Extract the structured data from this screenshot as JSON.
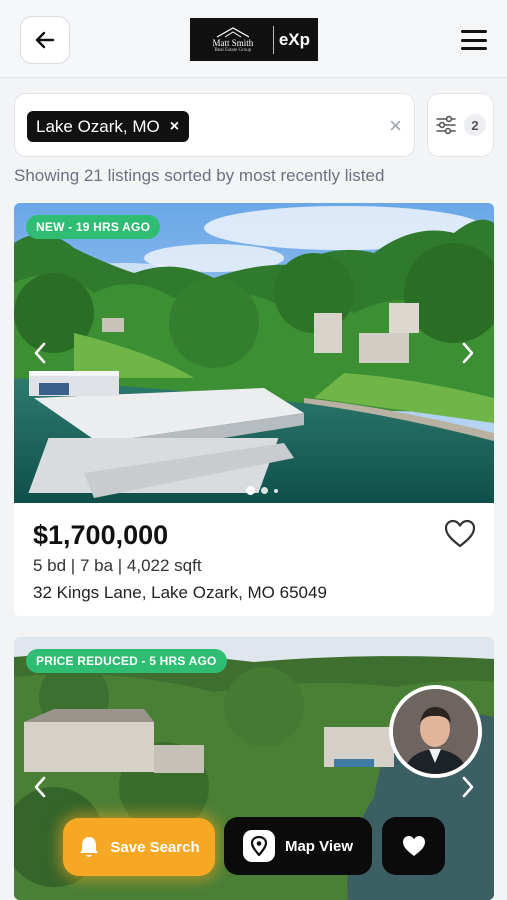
{
  "header": {
    "back_icon": "arrow-left-icon",
    "logo": {
      "name": "Matt Smith",
      "sub": "Real Estate Group",
      "brand": "eXp"
    },
    "menu_icon": "hamburger-menu-icon"
  },
  "search": {
    "chip_label": "Lake Ozark, MO",
    "chip_remove": "×",
    "clear": "×",
    "filter_icon": "sliders-icon",
    "filter_count": "2",
    "results_text": "Showing 21 listings sorted by most recently listed"
  },
  "listings": [
    {
      "badge": "NEW - 19 HRS AGO",
      "badge_color": "#2fbd73",
      "price": "$1,700,000",
      "specs": "5 bd | 7 ba | 4,022 sqft",
      "address": "32 Kings Lane, Lake Ozark, MO 65049",
      "photo_count": 3,
      "photo_index": 1
    },
    {
      "badge": "PRICE REDUCED - 5 HRS AGO",
      "badge_color": "#2fbd73"
    }
  ],
  "actions": {
    "save_search": "Save Search",
    "save_search_icon": "bell-icon",
    "map_view": "Map View",
    "map_view_icon": "map-pin-icon",
    "favorites_icon": "heart-icon",
    "accent": "#f6a723"
  }
}
